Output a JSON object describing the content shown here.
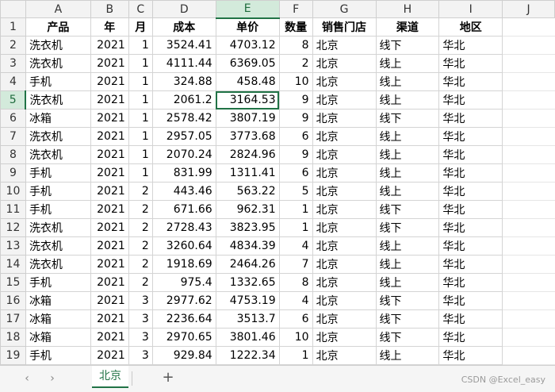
{
  "columns": [
    "A",
    "B",
    "C",
    "D",
    "E",
    "F",
    "G",
    "H",
    "I",
    "J"
  ],
  "header_row": [
    "产品",
    "年",
    "月",
    "成本",
    "单价",
    "数量",
    "销售门店",
    "渠道",
    "地区"
  ],
  "rows": [
    [
      "洗衣机",
      "2021",
      "1",
      "3524.41",
      "4703.12",
      "8",
      "北京",
      "线下",
      "华北"
    ],
    [
      "洗衣机",
      "2021",
      "1",
      "4111.44",
      "6369.05",
      "2",
      "北京",
      "线上",
      "华北"
    ],
    [
      "手机",
      "2021",
      "1",
      "324.88",
      "458.48",
      "10",
      "北京",
      "线上",
      "华北"
    ],
    [
      "洗衣机",
      "2021",
      "1",
      "2061.2",
      "3164.53",
      "9",
      "北京",
      "线上",
      "华北"
    ],
    [
      "冰箱",
      "2021",
      "1",
      "2578.42",
      "3807.19",
      "9",
      "北京",
      "线下",
      "华北"
    ],
    [
      "洗衣机",
      "2021",
      "1",
      "2957.05",
      "3773.68",
      "6",
      "北京",
      "线上",
      "华北"
    ],
    [
      "洗衣机",
      "2021",
      "1",
      "2070.24",
      "2824.96",
      "9",
      "北京",
      "线上",
      "华北"
    ],
    [
      "手机",
      "2021",
      "1",
      "831.99",
      "1311.41",
      "6",
      "北京",
      "线上",
      "华北"
    ],
    [
      "手机",
      "2021",
      "2",
      "443.46",
      "563.22",
      "5",
      "北京",
      "线上",
      "华北"
    ],
    [
      "手机",
      "2021",
      "2",
      "671.66",
      "962.31",
      "1",
      "北京",
      "线下",
      "华北"
    ],
    [
      "洗衣机",
      "2021",
      "2",
      "2728.43",
      "3823.95",
      "1",
      "北京",
      "线下",
      "华北"
    ],
    [
      "洗衣机",
      "2021",
      "2",
      "3260.64",
      "4834.39",
      "4",
      "北京",
      "线上",
      "华北"
    ],
    [
      "洗衣机",
      "2021",
      "2",
      "1918.69",
      "2464.26",
      "7",
      "北京",
      "线上",
      "华北"
    ],
    [
      "手机",
      "2021",
      "2",
      "975.4",
      "1332.65",
      "8",
      "北京",
      "线上",
      "华北"
    ],
    [
      "冰箱",
      "2021",
      "3",
      "2977.62",
      "4753.19",
      "4",
      "北京",
      "线下",
      "华北"
    ],
    [
      "冰箱",
      "2021",
      "3",
      "2236.64",
      "3513.7",
      "6",
      "北京",
      "线下",
      "华北"
    ],
    [
      "冰箱",
      "2021",
      "3",
      "2970.65",
      "3801.46",
      "10",
      "北京",
      "线下",
      "华北"
    ],
    [
      "手机",
      "2021",
      "3",
      "929.84",
      "1222.34",
      "1",
      "北京",
      "线上",
      "华北"
    ]
  ],
  "active_cell": {
    "column": "E",
    "row": 5
  },
  "sheet_tabs": [
    "北京"
  ],
  "tabbar": {
    "prev_icon": "chevron-left-icon",
    "next_icon": "chevron-right-icon",
    "add_icon": "plus-icon"
  },
  "watermark": "CSDN @Excel_easy",
  "colors": {
    "accent": "#217346",
    "active_header_bg": "#d3eadb",
    "header_bg": "#f3f3f3",
    "gridline": "#d4d4d4"
  }
}
